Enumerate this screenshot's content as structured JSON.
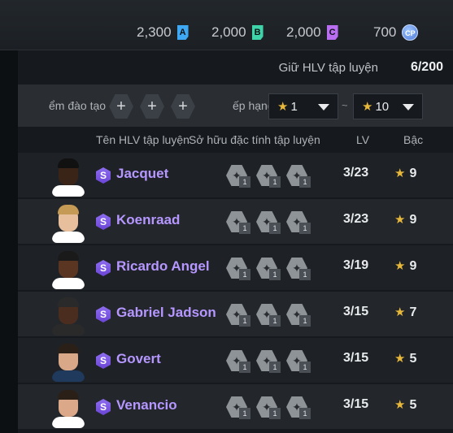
{
  "currencies": [
    {
      "value": "2,300",
      "letter": "A",
      "color": "#3fa8f4"
    },
    {
      "value": "2,000",
      "letter": "B",
      "color": "#3fd3a9"
    },
    {
      "value": "2,000",
      "letter": "C",
      "color": "#b96ef2"
    },
    {
      "value": "700",
      "letter": "CP",
      "color": "#6f9cf0"
    }
  ],
  "hold": {
    "label": "Giữ HLV tập luyện",
    "count": "6/200"
  },
  "filter": {
    "training_label": "ểm đào tạo",
    "plus_label": "+",
    "rank_label": "ếp hạng",
    "rank_from": "1",
    "rank_to": "10",
    "star": "★",
    "separator": "~"
  },
  "columns": {
    "name": "Tên HLV tập luyện",
    "traits": "Sở hữu đặc tính tập luyện",
    "lv": "LV",
    "rank": "Bậc"
  },
  "coaches": [
    {
      "badge": "S",
      "name": "Jacquet",
      "lv": "3/23",
      "rank": "9",
      "traits": [
        {
          "icon": "trait-icon",
          "level": "1"
        },
        {
          "icon": "trait-icon",
          "level": "1"
        },
        {
          "icon": "trait-icon",
          "level": "1"
        }
      ]
    },
    {
      "badge": "S",
      "name": "Koenraad",
      "lv": "3/23",
      "rank": "9",
      "traits": [
        {
          "icon": "trait-icon",
          "level": "1"
        },
        {
          "icon": "trait-icon",
          "level": "1"
        },
        {
          "icon": "trait-icon",
          "level": "1"
        }
      ]
    },
    {
      "badge": "S",
      "name": "Ricardo Angel",
      "lv": "3/19",
      "rank": "9",
      "traits": [
        {
          "icon": "trait-icon",
          "level": "1"
        },
        {
          "icon": "trait-icon",
          "level": "1"
        },
        {
          "icon": "trait-icon",
          "level": "1"
        }
      ]
    },
    {
      "badge": "S",
      "name": "Gabriel Jadson",
      "lv": "3/15",
      "rank": "7",
      "traits": [
        {
          "icon": "trait-icon",
          "level": "1"
        },
        {
          "icon": "trait-icon",
          "level": "1"
        },
        {
          "icon": "trait-icon",
          "level": "1"
        }
      ]
    },
    {
      "badge": "S",
      "name": "Govert",
      "lv": "3/15",
      "rank": "5",
      "traits": [
        {
          "icon": "trait-icon",
          "level": "1"
        },
        {
          "icon": "trait-icon",
          "level": "1"
        },
        {
          "icon": "trait-icon",
          "level": "1"
        }
      ]
    },
    {
      "badge": "S",
      "name": "Venancio",
      "lv": "3/15",
      "rank": "5",
      "traits": [
        {
          "icon": "trait-icon",
          "level": "1"
        },
        {
          "icon": "trait-icon",
          "level": "1"
        },
        {
          "icon": "trait-icon",
          "level": "1"
        }
      ]
    }
  ]
}
